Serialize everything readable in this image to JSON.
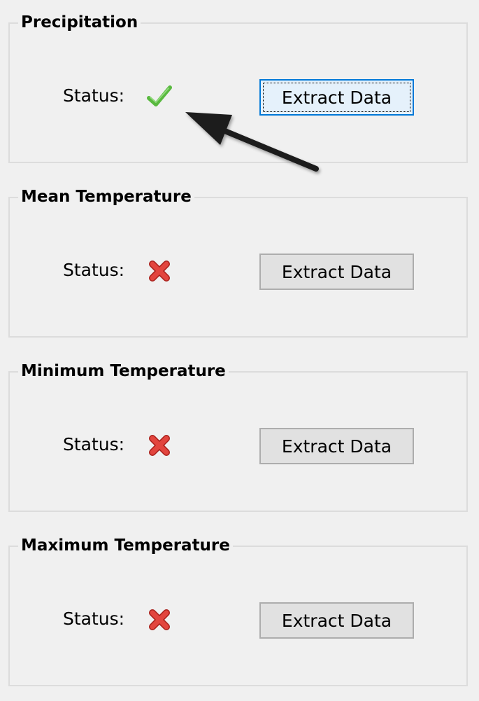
{
  "groups": [
    {
      "title": "Precipitation",
      "status_label": "Status:",
      "status": "success",
      "status_icon": "checkmark-icon",
      "button_label": "Extract Data",
      "focused": true
    },
    {
      "title": "Mean Temperature",
      "status_label": "Status:",
      "status": "error",
      "status_icon": "cross-icon",
      "button_label": "Extract Data",
      "focused": false
    },
    {
      "title": "Minimum Temperature",
      "status_label": "Status:",
      "status": "error",
      "status_icon": "cross-icon",
      "button_label": "Extract Data",
      "focused": false
    },
    {
      "title": "Maximum Temperature",
      "status_label": "Status:",
      "status": "error",
      "status_icon": "cross-icon",
      "button_label": "Extract Data",
      "focused": false
    }
  ],
  "colors": {
    "success": "#59b93f",
    "error": "#d6312a",
    "focus_border": "#0078d7",
    "annotation_arrow": "#1f1f1f"
  },
  "annotation": {
    "type": "arrow",
    "points_to": "precipitation-status-icon"
  }
}
